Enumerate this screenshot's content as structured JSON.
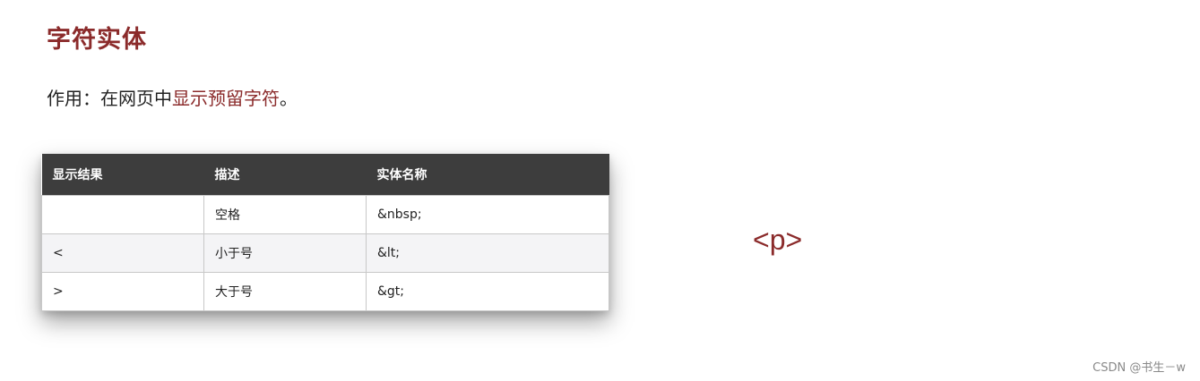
{
  "title": "字符实体",
  "description": {
    "prefix": "作用：在网页中",
    "highlight": "显示预留字符",
    "suffix": "。"
  },
  "table": {
    "headers": [
      "显示结果",
      "描述",
      "实体名称"
    ],
    "rows": [
      {
        "result": "",
        "desc": "空格",
        "entity": "&nbsp;"
      },
      {
        "result": "<",
        "desc": "小于号",
        "entity": "&lt;"
      },
      {
        "result": ">",
        "desc": "大于号",
        "entity": "&gt;"
      }
    ]
  },
  "example_tag": "<p>",
  "watermark": "CSDN @书生－w",
  "colors": {
    "accent": "#8b2b2b",
    "header_bg": "#3d3d3d",
    "alt_row_bg": "#f4f4f6"
  }
}
